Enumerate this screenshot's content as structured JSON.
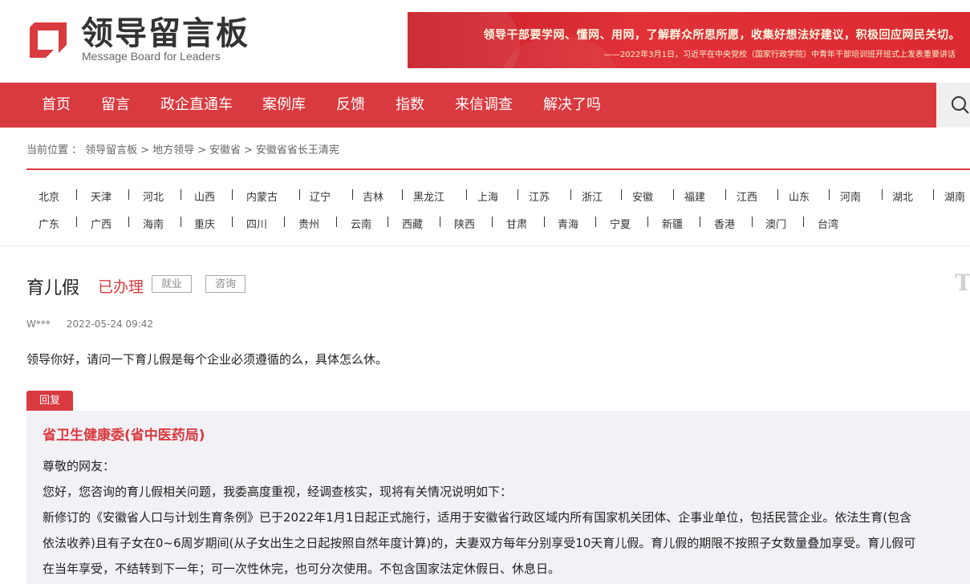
{
  "header": {
    "title": "领导留言板",
    "subtitle": "Message Board for Leaders",
    "banner_main": "领导干部要学网、懂网、用网，了解群众所思所愿，收集好想法好建议，积极回应网民关切。",
    "banner_quote": "——2022年3月1日，习近平在中央党校（国家行政学院）中青年干部培训班开班式上发表重要讲话",
    "brand_color": "#d93a3f"
  },
  "nav": {
    "items": [
      "首页",
      "留言",
      "政企直通车",
      "案例库",
      "反馈",
      "指数",
      "来信调查",
      "解决了吗"
    ],
    "search_icon": "search-icon"
  },
  "breadcrumb": {
    "prefix": "当前位置 ：",
    "items": [
      "领导留言板",
      ">",
      "地方领导",
      ">",
      "安徽省",
      ">",
      "安徽省省长王清宪"
    ]
  },
  "provinces": {
    "row1": [
      "北京",
      "天津",
      "河北",
      "山西",
      "内蒙古",
      "辽宁",
      "吉林",
      "黑龙江",
      "上海",
      "江苏",
      "浙江",
      "安徽",
      "福建",
      "江西",
      "山东",
      "河南",
      "湖北",
      "湖南"
    ],
    "row2": [
      "广东",
      "广西",
      "海南",
      "重庆",
      "四川",
      "贵州",
      "云南",
      "西藏",
      "陕西",
      "甘肃",
      "青海",
      "宁夏",
      "新疆",
      "香港",
      "澳门",
      "台湾"
    ]
  },
  "message": {
    "title": "育儿假",
    "status": "已办理",
    "tags": [
      "就业",
      "咨询"
    ],
    "author": "W***",
    "date": "2022-05-24 09:42",
    "body": "领导你好，请问一下育儿假是每个企业必须遵循的么，具体怎么休。"
  },
  "reply": {
    "badge": "回复",
    "org": "省卫生健康委(省中医药局)",
    "lines": [
      "尊敬的网友：",
      "您好，您咨询的育儿假相关问题，我委高度重视，经调查核实，现将有关情况说明如下：",
      "新修订的《安徽省人口与计划生育条例》已于2022年1月1日起正式施行，适用于安徽省行政区域内所有国家机关团体、企事业单位，包括民营企业。依法生育(包含",
      "依法收养)且有子女在0~6周岁期间(从子女出生之日起按照自然年度计算)的，夫妻双方每年分别享受10天育儿假。育儿假的期限不按照子女数量叠加享受。育儿假可",
      "在当年享受，不结转到下一年；可一次性休完，也可分次使用。不包含国家法定休假日、休息日。"
    ]
  }
}
